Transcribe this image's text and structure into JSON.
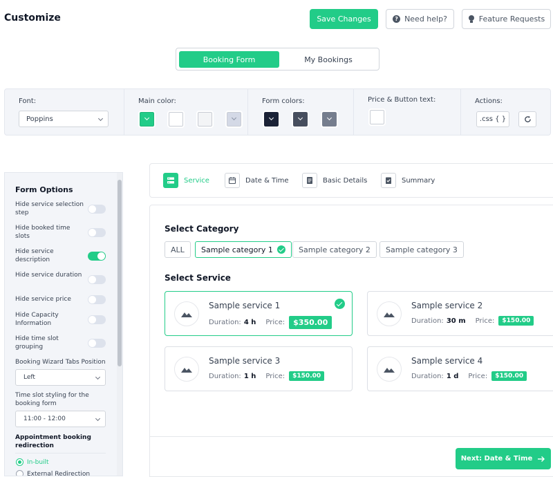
{
  "header": {
    "title": "Customize",
    "save_label": "Save Changes",
    "help_label": "Need help?",
    "feature_label": "Feature Requests"
  },
  "view_tabs": [
    {
      "label": "Booking Form",
      "active": true
    },
    {
      "label": "My Bookings",
      "active": false
    }
  ],
  "toolbar": {
    "font_label": "Font:",
    "font_value": "Poppins",
    "main_color_label": "Main color:",
    "main_colors": [
      "#22cc88",
      "#ffffff",
      "#f3f4f6",
      "#d4d9e6"
    ],
    "form_colors_label": "Form colors:",
    "form_colors": [
      "#1b2236",
      "#474e5e",
      "#767e8e"
    ],
    "price_button_label": "Price & Button text:",
    "price_button_color": "#ffffff",
    "actions_label": "Actions:",
    "css_label": ".css { }"
  },
  "sidebar": {
    "title": "Form Options",
    "options": [
      {
        "label": "Hide service selection step",
        "on": false
      },
      {
        "label": "Hide booked time slots",
        "on": false
      },
      {
        "label": "Hide service description",
        "on": true
      },
      {
        "label": "Hide service duration",
        "on": false
      },
      {
        "label": "Hide service price",
        "on": false
      },
      {
        "label": "Hide Capacity Information",
        "on": false
      },
      {
        "label": "Hide time slot grouping",
        "on": false
      }
    ],
    "wizard_tabs_label": "Booking Wizard Tabs Position",
    "wizard_tabs_value": "Left",
    "time_slot_label": "Time slot styling for the booking form",
    "time_slot_value": "11:00 - 12:00",
    "redirect_heading": "Appointment booking redirection",
    "redirect_options": [
      {
        "label": "In-built",
        "selected": true
      },
      {
        "label": "External Redirection",
        "selected": false
      }
    ]
  },
  "steps": [
    {
      "label": "Service",
      "active": true,
      "icon": "service-icon"
    },
    {
      "label": "Date & Time",
      "active": false,
      "icon": "calendar-icon"
    },
    {
      "label": "Basic Details",
      "active": false,
      "icon": "document-icon"
    },
    {
      "label": "Summary",
      "active": false,
      "icon": "clipboard-check-icon"
    }
  ],
  "main": {
    "category_title": "Select Category",
    "categories": [
      {
        "label": "ALL",
        "active": false
      },
      {
        "label": "Sample category 1",
        "active": true
      },
      {
        "label": "Sample category 2",
        "active": false
      },
      {
        "label": "Sample category 3",
        "active": false
      }
    ],
    "service_title": "Select Service",
    "duration_label": "Duration:",
    "price_label": "Price:",
    "services": [
      {
        "name": "Sample service 1",
        "duration": "4 h",
        "price": "$350.00",
        "selected": true
      },
      {
        "name": "Sample service 2",
        "duration": "30 m",
        "price": "$150.00",
        "selected": false
      },
      {
        "name": "Sample service 3",
        "duration": "1 h",
        "price": "$150.00",
        "selected": false
      },
      {
        "name": "Sample service 4",
        "duration": "1 d",
        "price": "$150.00",
        "selected": false
      }
    ],
    "next_label": "Next: Date & Time"
  }
}
